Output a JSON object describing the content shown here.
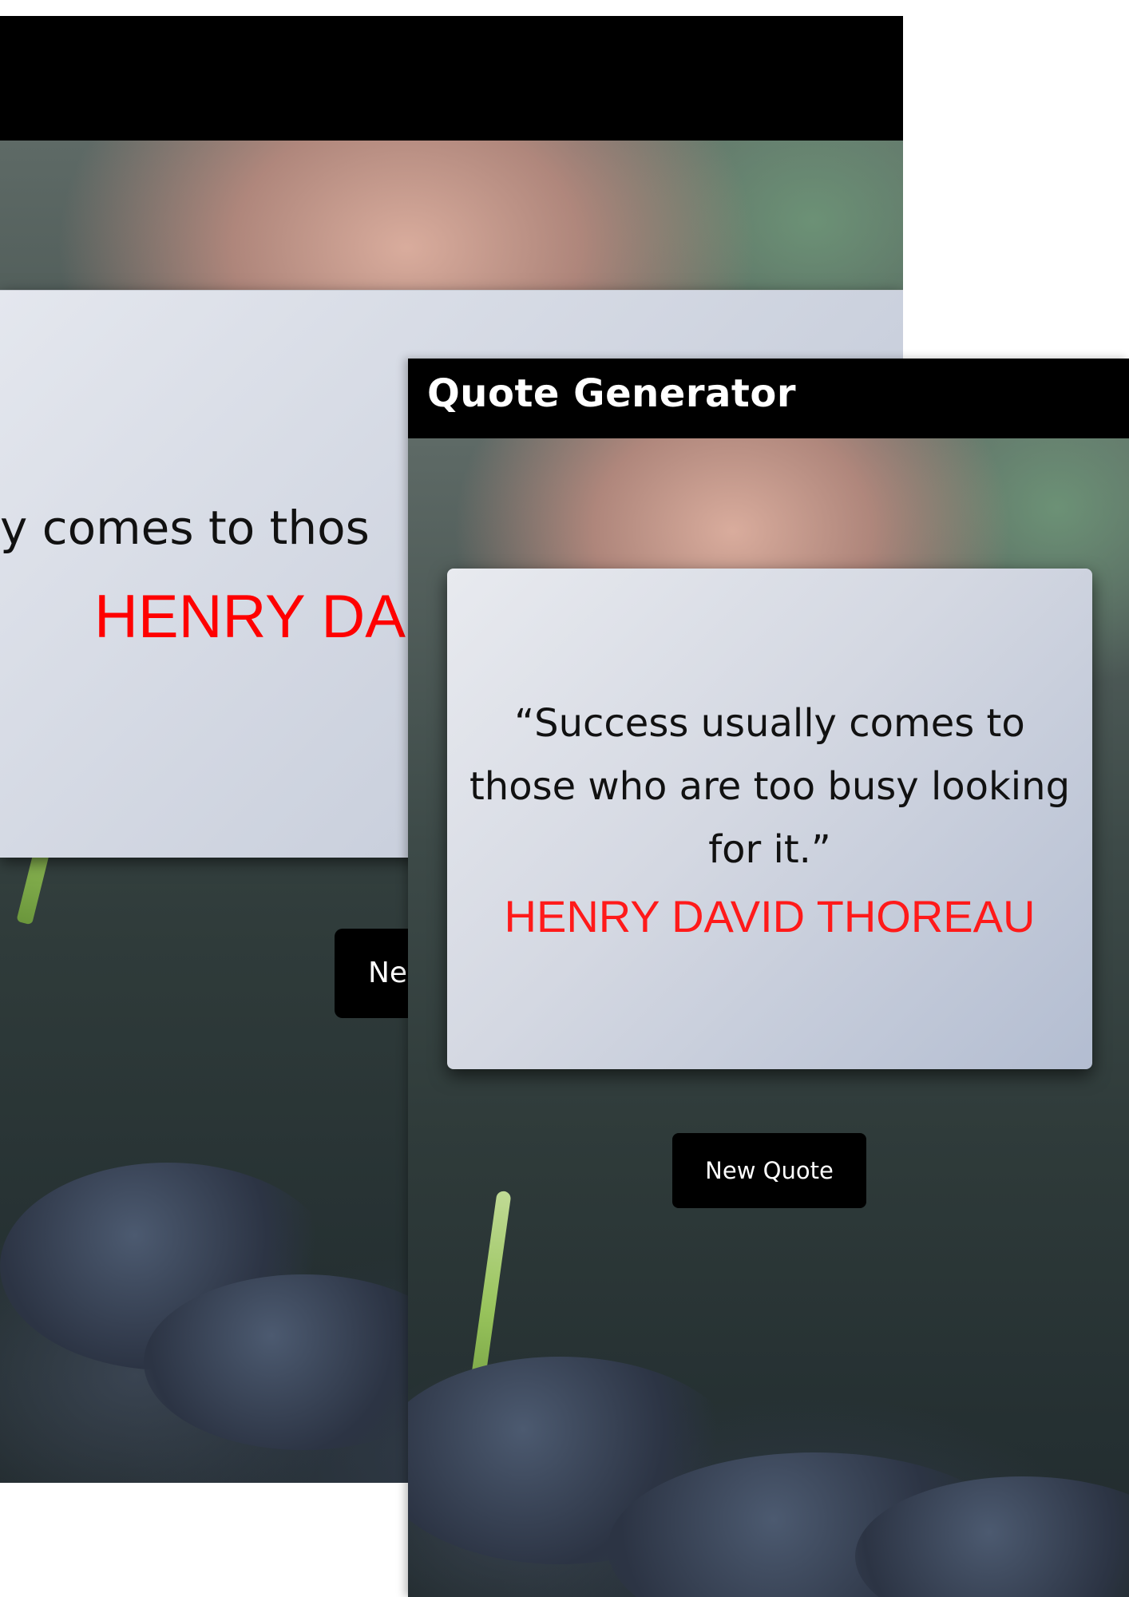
{
  "back_window": {
    "quote_fragment": "y comes to thos",
    "author_fragment": "HENRY DA",
    "button_fragment": "Ne"
  },
  "front_window": {
    "title": "Quote Generator",
    "quote": "“Success usually comes to those who are too busy looking for it.”",
    "author": "HENRY DAVID THOREAU",
    "new_quote_button": "New Quote"
  }
}
